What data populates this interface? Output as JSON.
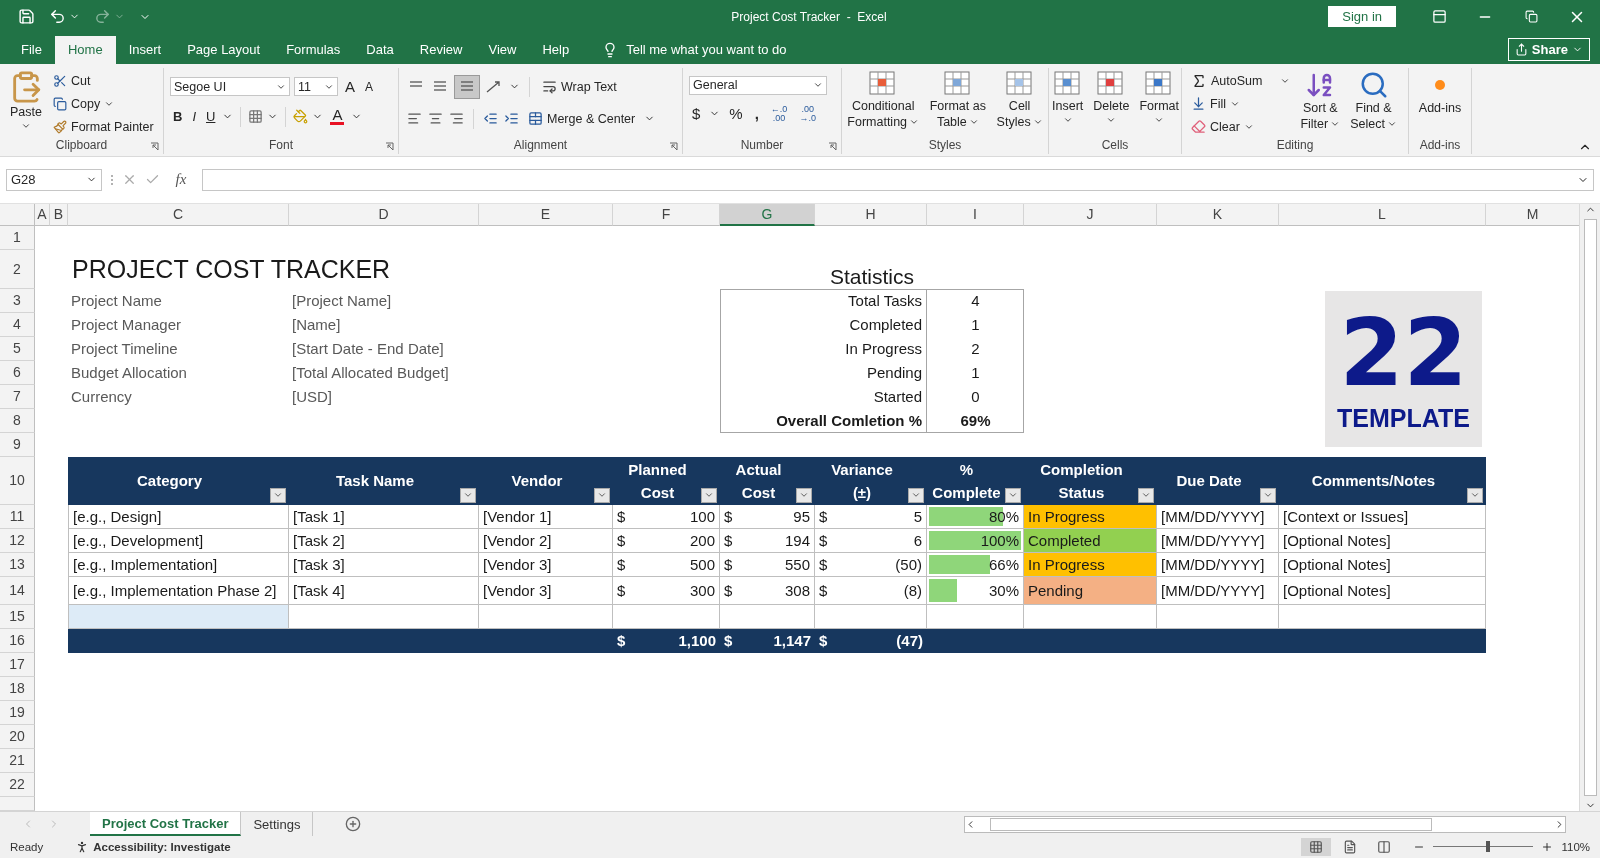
{
  "window": {
    "title": "Project Cost Tracker  -  Excel",
    "sign_in": "Sign in",
    "share": "Share"
  },
  "menu_tabs": [
    {
      "label": "File",
      "selected": false
    },
    {
      "label": "Home",
      "selected": true
    },
    {
      "label": "Insert",
      "selected": false
    },
    {
      "label": "Page Layout",
      "selected": false
    },
    {
      "label": "Formulas",
      "selected": false
    },
    {
      "label": "Data",
      "selected": false
    },
    {
      "label": "Review",
      "selected": false
    },
    {
      "label": "View",
      "selected": false
    },
    {
      "label": "Help",
      "selected": false
    }
  ],
  "tell_me": "Tell me what you want to do",
  "ribbon": {
    "clipboard": {
      "label": "Clipboard",
      "paste": "Paste",
      "cut": "Cut",
      "copy": "Copy",
      "format_painter": "Format Painter"
    },
    "font": {
      "label": "Font",
      "name": "Segoe UI",
      "size": "11",
      "grow": "A",
      "shrink": "A",
      "bold": "B",
      "italic": "I",
      "underline": "U",
      "font_color": "A"
    },
    "alignment": {
      "label": "Alignment",
      "wrap_text": "Wrap Text",
      "merge": "Merge & Center"
    },
    "number": {
      "label": "Number",
      "format": "General",
      "currency": "$",
      "percent": "%",
      "comma": ",",
      "decimals": [
        {
          "top": "←.0",
          "bottom": ".00"
        },
        {
          "top": ".00",
          "bottom": "→.0"
        }
      ]
    },
    "styles": {
      "label": "Styles",
      "buttons": [
        {
          "lines": [
            "Conditional",
            "Formatting"
          ]
        },
        {
          "lines": [
            "Format as",
            "Table"
          ]
        },
        {
          "lines": [
            "Cell",
            "Styles"
          ]
        }
      ]
    },
    "cells": {
      "label": "Cells",
      "buttons": [
        "Insert",
        "Delete",
        "Format"
      ]
    },
    "editing": {
      "label": "Editing",
      "autosum": "AutoSum",
      "fill": "Fill",
      "clear": "Clear",
      "buttons": [
        {
          "lines": [
            "Sort &",
            "Filter"
          ]
        },
        {
          "lines": [
            "Find &",
            "Select"
          ]
        }
      ]
    },
    "addins": {
      "label": "Add-ins",
      "button": "Add-ins"
    }
  },
  "formula_bar": {
    "name_box": "G28",
    "fx": "fx"
  },
  "columns": [
    {
      "label": "A",
      "selected": false
    },
    {
      "label": "B",
      "selected": false
    },
    {
      "label": "C",
      "selected": false
    },
    {
      "label": "D",
      "selected": false
    },
    {
      "label": "E",
      "selected": false
    },
    {
      "label": "F",
      "selected": false
    },
    {
      "label": "G",
      "selected": true
    },
    {
      "label": "H",
      "selected": false
    },
    {
      "label": "I",
      "selected": false
    },
    {
      "label": "J",
      "selected": false
    },
    {
      "label": "K",
      "selected": false
    },
    {
      "label": "L",
      "selected": false
    },
    {
      "label": "M",
      "selected": false
    }
  ],
  "row_numbers": [
    "1",
    "2",
    "3",
    "4",
    "5",
    "6",
    "7",
    "8",
    "9",
    "10",
    "11",
    "12",
    "13",
    "14",
    "15",
    "16",
    "17",
    "18",
    "19",
    "20",
    "21",
    "22"
  ],
  "sheet": {
    "title": "PROJECT COST TRACKER",
    "info": [
      {
        "label": "Project Name",
        "value": "[Project Name]"
      },
      {
        "label": "Project Manager",
        "value": "[Name]"
      },
      {
        "label": "Project Timeline",
        "value": "[Start Date - End Date]"
      },
      {
        "label": "Budget Allocation",
        "value": "[Total Allocated Budget]"
      },
      {
        "label": "Currency",
        "value": "[USD]"
      }
    ],
    "statistics": {
      "title": "Statistics",
      "rows": [
        {
          "label": "Total Tasks",
          "value": "4",
          "kind": "count"
        },
        {
          "label": "Completed",
          "value": "1",
          "kind": "count"
        },
        {
          "label": "In Progress",
          "value": "2",
          "kind": "count"
        },
        {
          "label": "Pending",
          "value": "1",
          "kind": "count"
        },
        {
          "label": "Started",
          "value": "0",
          "kind": "count"
        },
        {
          "label": "Overall Comletion %",
          "value": "69%",
          "kind": "total"
        }
      ]
    },
    "logo": {
      "digits": "22",
      "word": "TEMPLATE"
    },
    "table": {
      "columns": [
        {
          "lines": [
            "Category"
          ]
        },
        {
          "lines": [
            "Task Name"
          ]
        },
        {
          "lines": [
            "Vendor"
          ]
        },
        {
          "lines": [
            "Planned",
            "Cost"
          ]
        },
        {
          "lines": [
            "Actual",
            "Cost"
          ]
        },
        {
          "lines": [
            "Variance",
            "(±)"
          ]
        },
        {
          "lines": [
            "%",
            "Complete"
          ]
        },
        {
          "lines": [
            "Completion",
            "Status"
          ]
        },
        {
          "lines": [
            "Due Date"
          ]
        },
        {
          "lines": [
            "Comments/Notes"
          ]
        }
      ],
      "rows": [
        {
          "category": "[e.g., Design]",
          "task": "[Task 1]",
          "vendor": "[Vendor 1]",
          "planned": {
            "symbol": "$",
            "amount": "100"
          },
          "actual": {
            "symbol": "$",
            "amount": "95"
          },
          "variance": {
            "symbol": "$",
            "amount": "5"
          },
          "complete": {
            "text": "80%",
            "level": 0.8
          },
          "status": {
            "text": "In Progress",
            "color": "#ffc000"
          },
          "due": "[MM/DD/YYYY]",
          "notes": "[Context or Issues]"
        },
        {
          "category": "[e.g., Development]",
          "task": "[Task 2]",
          "vendor": "[Vendor 2]",
          "planned": {
            "symbol": "$",
            "amount": "200"
          },
          "actual": {
            "symbol": "$",
            "amount": "194"
          },
          "variance": {
            "symbol": "$",
            "amount": "6"
          },
          "complete": {
            "text": "100%",
            "level": 1
          },
          "status": {
            "text": "Completed",
            "color": "#92d050"
          },
          "due": "[MM/DD/YYYY]",
          "notes": "[Optional Notes]"
        },
        {
          "category": "[e.g., Implementation]",
          "task": "[Task 3]",
          "vendor": "[Vendor 3]",
          "planned": {
            "symbol": "$",
            "amount": "500"
          },
          "actual": {
            "symbol": "$",
            "amount": "550"
          },
          "variance": {
            "symbol": "$",
            "amount": "(50)"
          },
          "complete": {
            "text": "66%",
            "level": 0.66
          },
          "status": {
            "text": "In Progress",
            "color": "#ffc000"
          },
          "due": "[MM/DD/YYYY]",
          "notes": "[Optional Notes]"
        },
        {
          "category": "[e.g., Implementation Phase 2]",
          "task": "[Task 4]",
          "vendor": "[Vendor 3]",
          "planned": {
            "symbol": "$",
            "amount": "300"
          },
          "actual": {
            "symbol": "$",
            "amount": "308"
          },
          "variance": {
            "symbol": "$",
            "amount": "(8)"
          },
          "complete": {
            "text": "30%",
            "level": 0.3
          },
          "status": {
            "text": "Pending",
            "color": "#f4b084"
          },
          "due": "[MM/DD/YYYY]",
          "notes": "[Optional Notes]"
        }
      ],
      "totals": {
        "planned": {
          "symbol": "$",
          "amount": "1,100"
        },
        "actual": {
          "symbol": "$",
          "amount": "1,147"
        },
        "variance": {
          "symbol": "$",
          "amount": "(47)"
        }
      }
    }
  },
  "sheet_tabs": [
    {
      "label": "Project Cost Tracker",
      "selected": true
    },
    {
      "label": "Settings",
      "selected": false
    }
  ],
  "status_bar": {
    "ready": "Ready",
    "accessibility": "Accessibility: Investigate",
    "zoom": "110%",
    "level": 0.55
  }
}
